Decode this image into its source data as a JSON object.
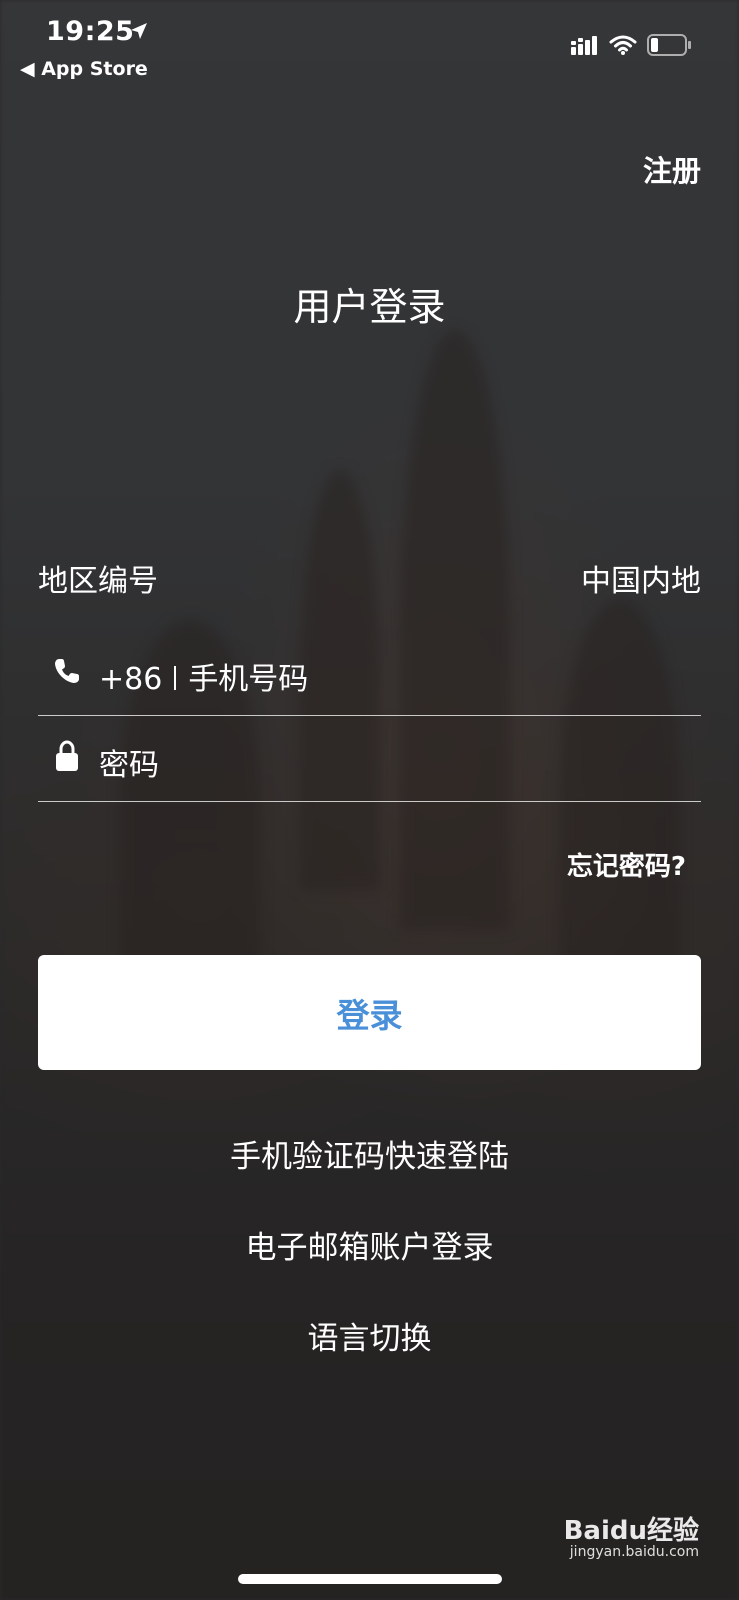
{
  "status_bar": {
    "time": "19:25",
    "back_label": "◀ App Store",
    "icons": [
      "location-arrow-icon",
      "signal-icon",
      "wifi-icon",
      "battery-icon"
    ]
  },
  "header": {
    "register_label": "注册",
    "title": "用户登录"
  },
  "region": {
    "label": "地区编号",
    "value": "中国内地"
  },
  "phone_field": {
    "prefix": "+86",
    "placeholder": "手机号码",
    "icon": "phone-icon"
  },
  "password_field": {
    "placeholder": "密码",
    "icon": "lock-icon"
  },
  "forgot_label": "忘记密码?",
  "login_button": "登录",
  "alt_options": [
    "手机验证码快速登陆",
    "电子邮箱账户登录",
    "语言切换"
  ],
  "watermark": {
    "brand": "Baidu经验",
    "url": "jingyan.baidu.com"
  },
  "colors": {
    "accent": "#4a90d9",
    "background": "#2a2a2c",
    "text": "#ffffff"
  }
}
